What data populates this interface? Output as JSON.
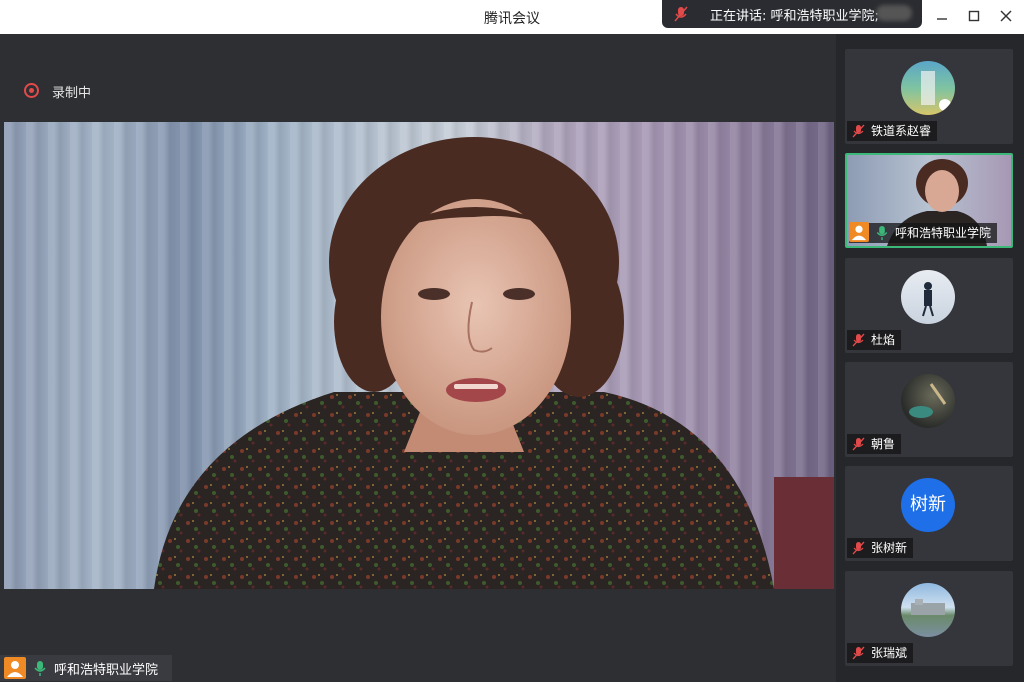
{
  "window": {
    "title": "腾讯会议",
    "minimize_icon": "minimize-icon",
    "maximize_icon": "maximize-icon",
    "close_icon": "close-icon"
  },
  "speaker_banner": {
    "text": "正在讲话: 呼和浩特职业学院;"
  },
  "recording": {
    "label": "录制中"
  },
  "main_video": {
    "participant_name": "呼和浩特职业学院"
  },
  "participants": [
    {
      "name": "铁道系赵睿",
      "mic": "muted",
      "avatar": "photo"
    },
    {
      "name": "呼和浩特职业学院",
      "mic": "on",
      "avatar": "video",
      "active": true
    },
    {
      "name": "杜焰",
      "mic": "muted",
      "avatar": "photo"
    },
    {
      "name": "朝鲁",
      "mic": "muted",
      "avatar": "photo"
    },
    {
      "name": "张树新",
      "mic": "muted",
      "avatar": "text",
      "avatar_text": "树新"
    },
    {
      "name": "张瑞斌",
      "mic": "muted",
      "avatar": "photo"
    }
  ],
  "colors": {
    "accent_green": "#3cb878",
    "record_red": "#e24a4a",
    "host_orange": "#f08a24",
    "text_avatar_blue": "#1e6fe8"
  }
}
